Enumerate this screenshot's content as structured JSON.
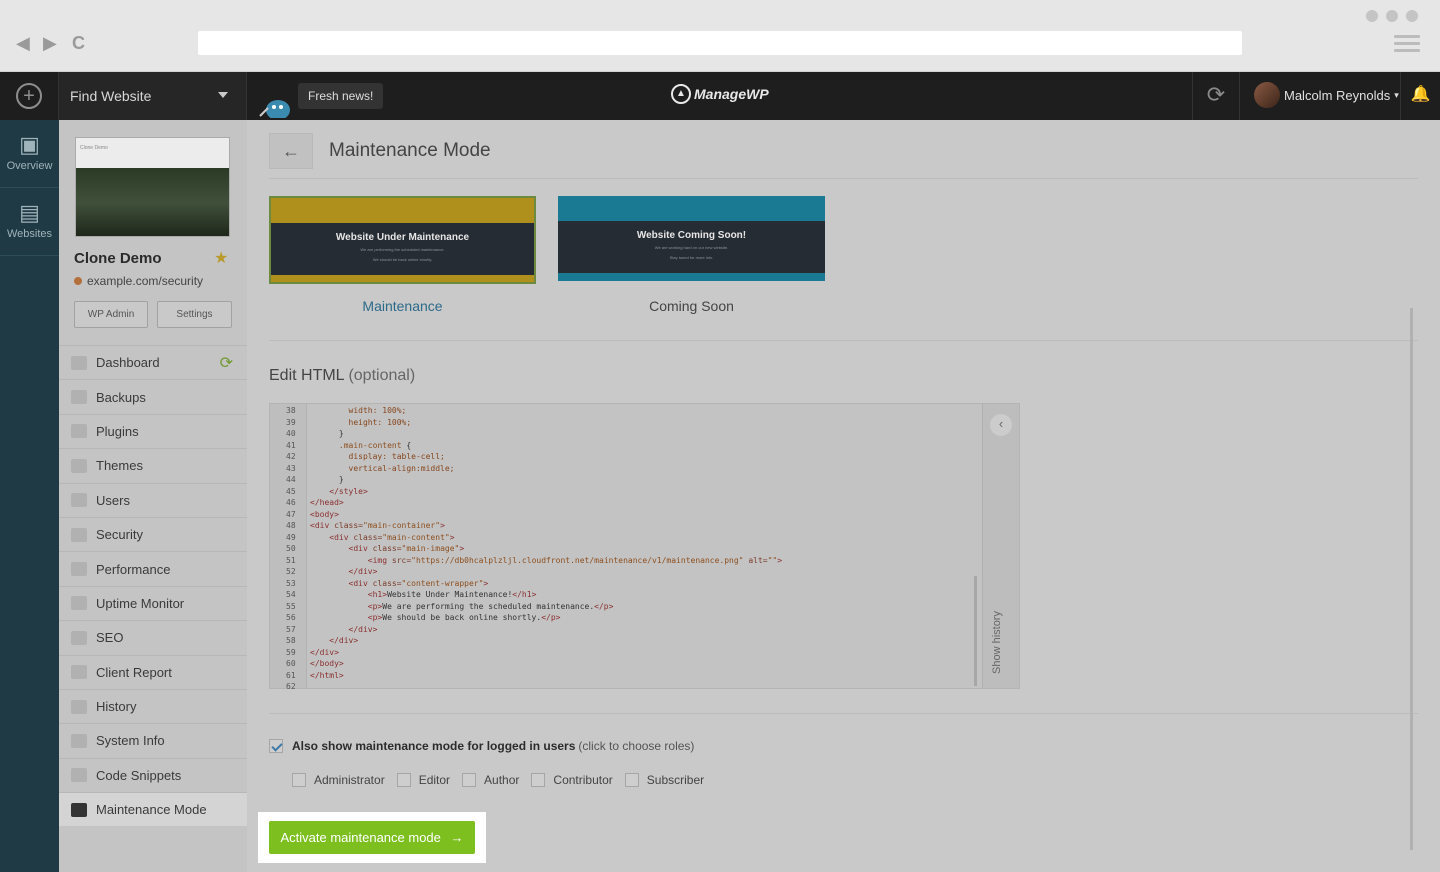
{
  "browser": {
    "back": "◀",
    "forward": "▶",
    "reload": "C"
  },
  "topbar": {
    "find_website": "Find Website",
    "news": "Fresh news!",
    "logo": "ManageWP",
    "user_name": "Malcolm Reynolds",
    "user_caret": "▾"
  },
  "leftbar": {
    "items": [
      {
        "label": "Overview",
        "icon": "monitor-chart-icon"
      },
      {
        "label": "Websites",
        "icon": "websites-icon"
      }
    ]
  },
  "site": {
    "title": "Clone Demo",
    "url": "example.com/security",
    "wp_admin": "WP Admin",
    "settings": "Settings",
    "thumb_title": "Clone Demo"
  },
  "menu": [
    {
      "label": "Dashboard"
    },
    {
      "label": "Backups"
    },
    {
      "label": "Plugins"
    },
    {
      "label": "Themes"
    },
    {
      "label": "Users"
    },
    {
      "label": "Security"
    },
    {
      "label": "Performance"
    },
    {
      "label": "Uptime Monitor"
    },
    {
      "label": "SEO"
    },
    {
      "label": "Client Report"
    },
    {
      "label": "History"
    },
    {
      "label": "System Info"
    },
    {
      "label": "Code Snippets"
    },
    {
      "label": "Maintenance Mode"
    }
  ],
  "page": {
    "title": "Maintenance Mode",
    "back": "←"
  },
  "templates": [
    {
      "label": "Maintenance",
      "heading": "Website Under Maintenance",
      "sub1": "We are performing the scheduled maintenance.",
      "sub2": "We should be back online shortly.",
      "band": "#b0901c",
      "label_color": "#2d6a8a"
    },
    {
      "label": "Coming Soon",
      "heading": "Website Coming Soon!",
      "sub1": "We are working hard on our new website.",
      "sub2": "Stay tuned for more info.",
      "band": "#1a7a93",
      "label_color": "#444444"
    }
  ],
  "editor": {
    "title": "Edit HTML",
    "optional": "(optional)",
    "history": "Show history",
    "chevron": "‹",
    "line_numbers": [
      "38",
      "39",
      "40",
      "41",
      "42",
      "43",
      "44",
      "45",
      "46",
      "47",
      "48",
      "49",
      "50",
      "51",
      "52",
      "53",
      "54",
      "55",
      "56",
      "57",
      "58",
      "59",
      "60",
      "61",
      "62"
    ]
  },
  "logged_in": {
    "label": "Also show maintenance mode for logged in users",
    "hint": "(click to choose roles)",
    "checked": true,
    "roles": [
      "Administrator",
      "Editor",
      "Author",
      "Contributor",
      "Subscriber"
    ]
  },
  "activate": {
    "label": "Activate maintenance mode",
    "arrow": "→"
  },
  "colors": {
    "accent": "#7cbf1f",
    "sidebar": "#1f3a44"
  }
}
